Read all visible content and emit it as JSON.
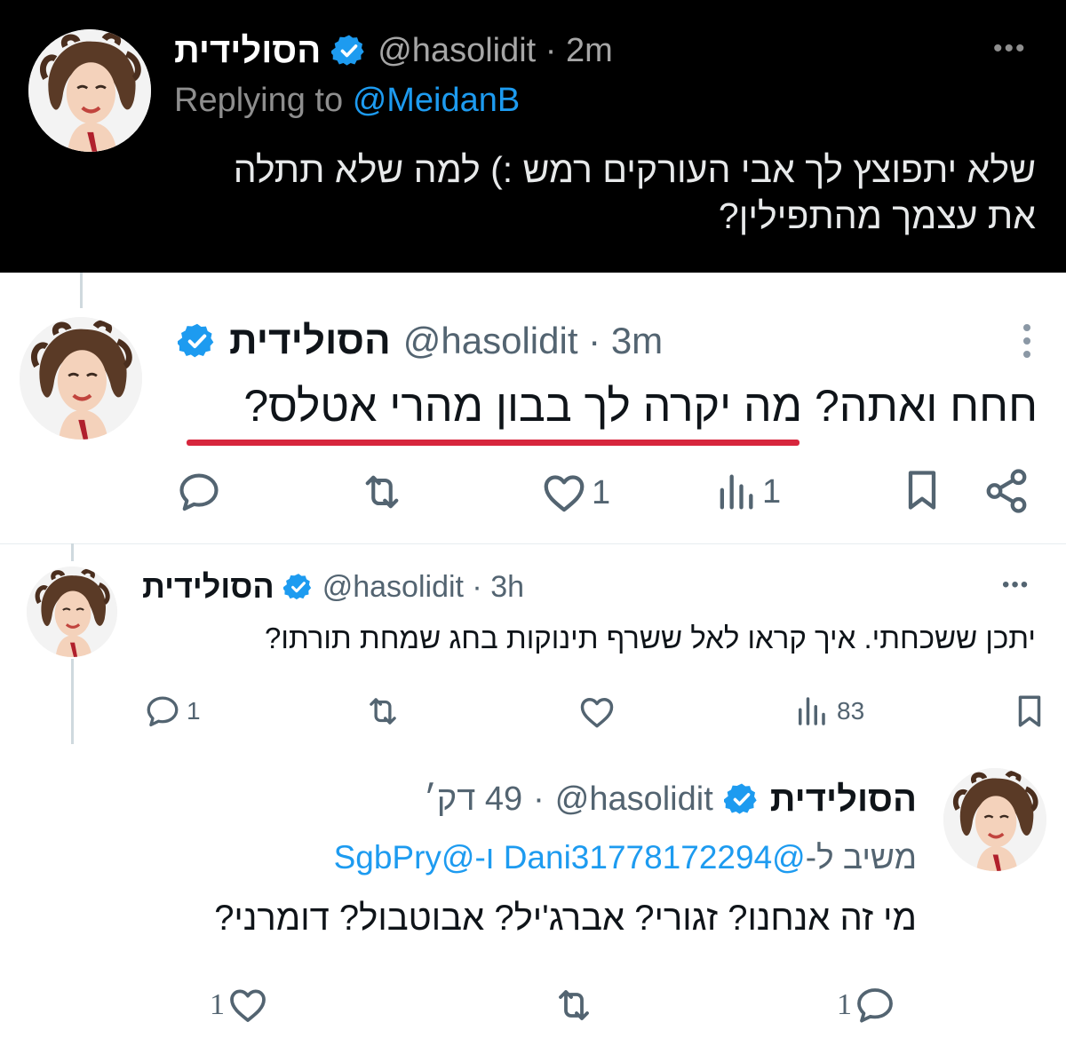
{
  "colors": {
    "accent": "#1d9bf0",
    "verified": "#1d9bf0",
    "underline": "#d7263d",
    "dark_bg": "#000000"
  },
  "tweet1": {
    "display_name": "הסולידית",
    "handle_time": "@hasolidit · 2m",
    "replying_prefix": "Replying to",
    "replying_mention": "@MeidanB",
    "text_line1": "שלא יתפוצץ לך אבי העורקים רמש :) למה שלא תתלה",
    "text_line2": "את עצמך מהתפילין?",
    "more": "•••"
  },
  "tweet2": {
    "display_name": "הסולידית",
    "handle_time": "@hasolidit · 3m",
    "text": "חחח ואתה? מה יקרה לך בבון מהרי אטלס?",
    "actions": {
      "reply_count": "",
      "retweet_count": "",
      "like_count": "1",
      "view_count": "1"
    }
  },
  "tweet3": {
    "display_name": "הסולידית",
    "handle_time": "@hasolidit · 3h",
    "text": "יתכן ששכחתי. איך קראו לאל ששרף תינוקות בחג שמחת תורתו?",
    "more": "•••",
    "actions": {
      "reply_count": "1",
      "view_count": "83"
    }
  },
  "tweet4": {
    "display_name": "הסולידית",
    "handle": "@hasolidit",
    "time": "49 דק׳",
    "reply_prefix": "משיב ל-",
    "reply_mentions": "@Dani31778172294 ו-@SgbPry",
    "text": "מי זה אנחנו? זגורי? אברג'יל? אבוטבול? דומרני?",
    "actions": {
      "like_count": "1",
      "reply_count": "1"
    }
  },
  "icons": [
    "verified-badge-icon",
    "more-icon",
    "reply-icon",
    "retweet-icon",
    "like-icon",
    "views-icon",
    "bookmark-icon",
    "share-icon"
  ]
}
